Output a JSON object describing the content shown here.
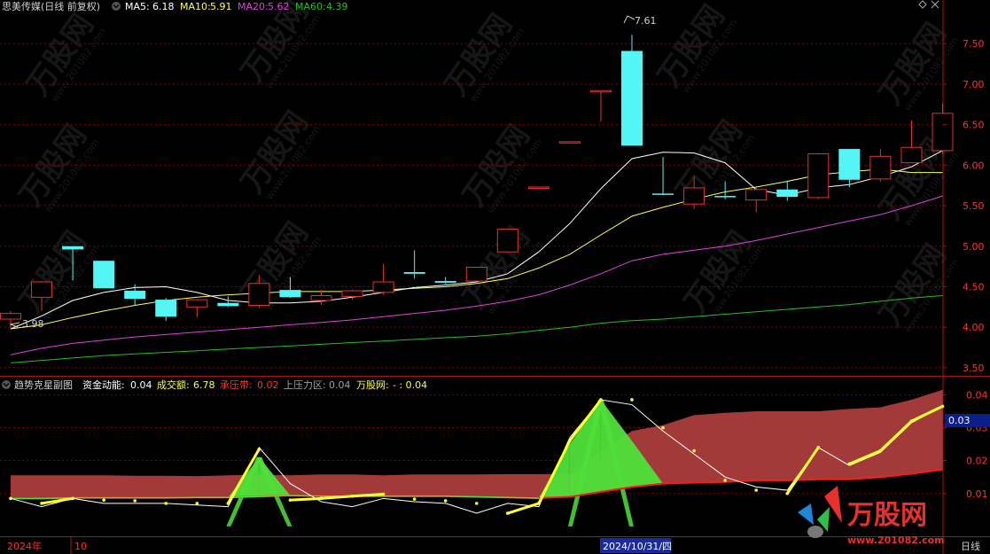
{
  "colors": {
    "bg": "#000000",
    "grid": "#8b0000",
    "frame": "#b01010",
    "up": "#e8302c",
    "down": "#54f5f5",
    "ma5": "#ffffff",
    "ma10": "#ffff4a",
    "ma20": "#e040e0",
    "ma60": "#20c020",
    "band": "#a33a3a",
    "pressure": "#ff1a1a",
    "green_fill": "#4fe03a",
    "flow": "#ffff30",
    "white_line": "#ffffff",
    "text": "#c0c0c0",
    "red_text": "#ff3030"
  },
  "main_header": {
    "title": "思美传媒(日线 前复权)",
    "ma5_label": "MA5:",
    "ma5_value": "6.18",
    "ma10_label": "MA10:",
    "ma10_value": "5.91",
    "ma20_label": "MA20:",
    "ma20_value": "5.62",
    "ma60_label": "MA60:",
    "ma60_value": "4.39"
  },
  "sub_header": {
    "title": "趋势克星副图",
    "zjdn_label": "资金动能:",
    "zjdn_value": "0.04",
    "cje_label": "成交额:",
    "cje_value": "6.78",
    "cyd_label": "承压带:",
    "cyd_value": "0.02",
    "sylq_label": "上压力区:",
    "sylq_value": "0.04",
    "wgw_label": "万股网:",
    "wgw_value": "- : 0.04"
  },
  "annotations": {
    "high_label": "7.61",
    "low_label": "3.98",
    "current_sub_value": "0.03"
  },
  "bottom_bar": {
    "year_label": "2024年",
    "month_label": "10",
    "cursor_date": "2024/10/31/四",
    "period_label": "日线"
  },
  "watermark": {
    "brand": "万股网",
    "url": "www.201082.com"
  },
  "chart_data": [
    {
      "type": "candlestick",
      "title": "思美传媒(日线 前复权)",
      "y_ticks": [
        3.5,
        4.0,
        4.5,
        5.0,
        5.5,
        6.0,
        6.5,
        7.0,
        7.5
      ],
      "y_tick_labels": [
        "3.50",
        "4.00",
        "4.50",
        "5.00",
        "5.50",
        "6.00",
        "6.50",
        "7.00",
        "7.50"
      ],
      "ylim": [
        3.4,
        7.82
      ],
      "candles": [
        {
          "o": 4.1,
          "h": 4.2,
          "l": 3.98,
          "c": 4.17
        },
        {
          "o": 4.37,
          "h": 4.57,
          "l": 4.2,
          "c": 4.56
        },
        {
          "o": 5.0,
          "h": 5.0,
          "l": 4.58,
          "c": 4.96
        },
        {
          "o": 4.82,
          "h": 4.82,
          "l": 4.48,
          "c": 4.48
        },
        {
          "o": 4.45,
          "h": 4.53,
          "l": 4.27,
          "c": 4.35
        },
        {
          "o": 4.34,
          "h": 4.36,
          "l": 4.08,
          "c": 4.13
        },
        {
          "o": 4.25,
          "h": 4.35,
          "l": 4.12,
          "c": 4.34
        },
        {
          "o": 4.3,
          "h": 4.38,
          "l": 4.25,
          "c": 4.26
        },
        {
          "o": 4.27,
          "h": 4.64,
          "l": 4.24,
          "c": 4.54
        },
        {
          "o": 4.46,
          "h": 4.62,
          "l": 4.36,
          "c": 4.37
        },
        {
          "o": 4.33,
          "h": 4.46,
          "l": 4.28,
          "c": 4.39
        },
        {
          "o": 4.38,
          "h": 4.46,
          "l": 4.34,
          "c": 4.45
        },
        {
          "o": 4.43,
          "h": 4.78,
          "l": 4.4,
          "c": 4.56
        },
        {
          "o": 4.68,
          "h": 4.95,
          "l": 4.6,
          "c": 4.66
        },
        {
          "o": 4.57,
          "h": 4.62,
          "l": 4.53,
          "c": 4.55
        },
        {
          "o": 4.57,
          "h": 4.74,
          "l": 4.57,
          "c": 4.74
        },
        {
          "o": 4.93,
          "h": 5.21,
          "l": 4.93,
          "c": 5.21
        },
        {
          "o": 5.73,
          "h": 5.73,
          "l": 5.73,
          "c": 5.73
        },
        {
          "o": 6.29,
          "h": 6.29,
          "l": 6.29,
          "c": 6.29
        },
        {
          "o": 6.92,
          "h": 6.92,
          "l": 6.54,
          "c": 6.92
        },
        {
          "o": 7.41,
          "h": 7.61,
          "l": 6.24,
          "c": 6.24
        },
        {
          "o": 5.65,
          "h": 6.1,
          "l": 5.63,
          "c": 5.64
        },
        {
          "o": 5.52,
          "h": 5.86,
          "l": 5.46,
          "c": 5.72
        },
        {
          "o": 5.62,
          "h": 5.8,
          "l": 5.58,
          "c": 5.61
        },
        {
          "o": 5.57,
          "h": 5.72,
          "l": 5.42,
          "c": 5.7
        },
        {
          "o": 5.7,
          "h": 5.81,
          "l": 5.56,
          "c": 5.61
        },
        {
          "o": 5.6,
          "h": 6.15,
          "l": 5.58,
          "c": 6.14
        },
        {
          "o": 6.2,
          "h": 6.2,
          "l": 5.73,
          "c": 5.82
        },
        {
          "o": 5.83,
          "h": 6.2,
          "l": 5.8,
          "c": 6.11
        },
        {
          "o": 6.03,
          "h": 6.55,
          "l": 6.03,
          "c": 6.22
        },
        {
          "o": 6.18,
          "h": 6.76,
          "l": 6.14,
          "c": 6.64
        }
      ],
      "ma5": [
        3.98,
        4.14,
        4.33,
        4.43,
        4.49,
        4.5,
        4.43,
        4.33,
        4.3,
        4.3,
        4.32,
        4.37,
        4.43,
        4.49,
        4.52,
        4.56,
        4.66,
        4.93,
        5.28,
        5.71,
        6.08,
        6.16,
        6.15,
        6.03,
        5.7,
        5.63,
        5.72,
        5.76,
        5.86,
        5.98,
        6.18
      ],
      "ma10": [
        3.98,
        4.03,
        4.12,
        4.2,
        4.27,
        4.33,
        4.37,
        4.4,
        4.42,
        4.44,
        4.44,
        4.44,
        4.46,
        4.48,
        4.5,
        4.54,
        4.6,
        4.73,
        4.9,
        5.14,
        5.37,
        5.48,
        5.58,
        5.67,
        5.73,
        5.8,
        5.88,
        5.92,
        5.95,
        5.91,
        5.91
      ],
      "ma20": [
        3.66,
        3.74,
        3.8,
        3.84,
        3.88,
        3.91,
        3.94,
        3.97,
        4.0,
        4.03,
        4.06,
        4.09,
        4.13,
        4.17,
        4.21,
        4.26,
        4.32,
        4.4,
        4.52,
        4.66,
        4.82,
        4.9,
        4.95,
        5.0,
        5.07,
        5.15,
        5.23,
        5.31,
        5.39,
        5.5,
        5.62
      ],
      "ma60": [
        3.56,
        3.59,
        3.62,
        3.65,
        3.67,
        3.69,
        3.71,
        3.73,
        3.75,
        3.77,
        3.79,
        3.81,
        3.83,
        3.85,
        3.87,
        3.89,
        3.92,
        3.96,
        4.0,
        4.05,
        4.08,
        4.1,
        4.13,
        4.16,
        4.19,
        4.22,
        4.25,
        4.28,
        4.32,
        4.36,
        4.39
      ]
    },
    {
      "type": "area",
      "title": "趋势克星副图",
      "y_ticks": [
        0.01,
        0.02,
        0.03,
        0.04
      ],
      "y_tick_labels": [
        "0.01",
        "0.02",
        "0.03",
        "0.04"
      ],
      "ylim": [
        -0.003,
        0.0455
      ],
      "series": [
        {
          "name": "上压力区",
          "values": [
            0.0155,
            0.0155,
            0.0155,
            0.0155,
            0.0154,
            0.0154,
            0.0153,
            0.0155,
            0.0157,
            0.0155,
            0.0158,
            0.0158,
            0.0155,
            0.0158,
            0.0158,
            0.0158,
            0.0159,
            0.0159,
            0.016,
            0.0225,
            0.029,
            0.0308,
            0.0338,
            0.0345,
            0.035,
            0.035,
            0.035,
            0.0357,
            0.0362,
            0.0385,
            0.0415
          ]
        },
        {
          "name": "承压带",
          "values": [
            0.0085,
            0.0085,
            0.0087,
            0.0087,
            0.0087,
            0.0087,
            0.0088,
            0.0088,
            0.0091,
            0.0094,
            0.0092,
            0.0092,
            0.0092,
            0.0092,
            0.0092,
            0.009,
            0.0088,
            0.0086,
            0.009,
            0.0105,
            0.012,
            0.013,
            0.0133,
            0.0135,
            0.014,
            0.014,
            0.0143,
            0.0143,
            0.015,
            0.016,
            0.0173
          ]
        },
        {
          "name": "资金动能",
          "values": [
            0.0085,
            0.007,
            0.0085,
            0.008,
            0.0078,
            0.007,
            0.007,
            0.007,
            0.0235,
            0.008,
            0.0085,
            0.0092,
            0.0098,
            0.0083,
            0.0078,
            0.007,
            0.004,
            0.007,
            0.026,
            0.0385,
            0.0385,
            0.03,
            0.023,
            0.014,
            0.011,
            0.01,
            0.024,
            0.019,
            0.023,
            0.032,
            0.0365
          ]
        },
        {
          "name": "green_bars",
          "values": [
            0.0085,
            0.0085,
            0.0087,
            0.0087,
            0.0087,
            0.0087,
            0.0088,
            0.0088,
            0.021,
            0.0094,
            0.0092,
            0.0092,
            0.0092,
            0.0092,
            0.0092,
            0.009,
            0.0088,
            0.0086,
            0.025,
            0.0385,
            0.026,
            0.013,
            0.0133,
            0.0135,
            0.014,
            0.014,
            0.0143,
            0.0143,
            0.015,
            0.016,
            0.0173
          ]
        },
        {
          "name": "white_line",
          "values": [
            0.0085,
            0.006,
            0.0085,
            0.007,
            0.007,
            0.007,
            0.0065,
            0.006,
            0.024,
            0.013,
            0.0075,
            0.006,
            0.0085,
            0.0075,
            0.007,
            0.004,
            0.007,
            0.006,
            0.027,
            0.0385,
            0.037,
            0.029,
            0.022,
            0.015,
            0.012,
            0.011,
            0.024,
            0.0185,
            0.0225,
            0.0315,
            0.0365
          ]
        }
      ]
    }
  ]
}
